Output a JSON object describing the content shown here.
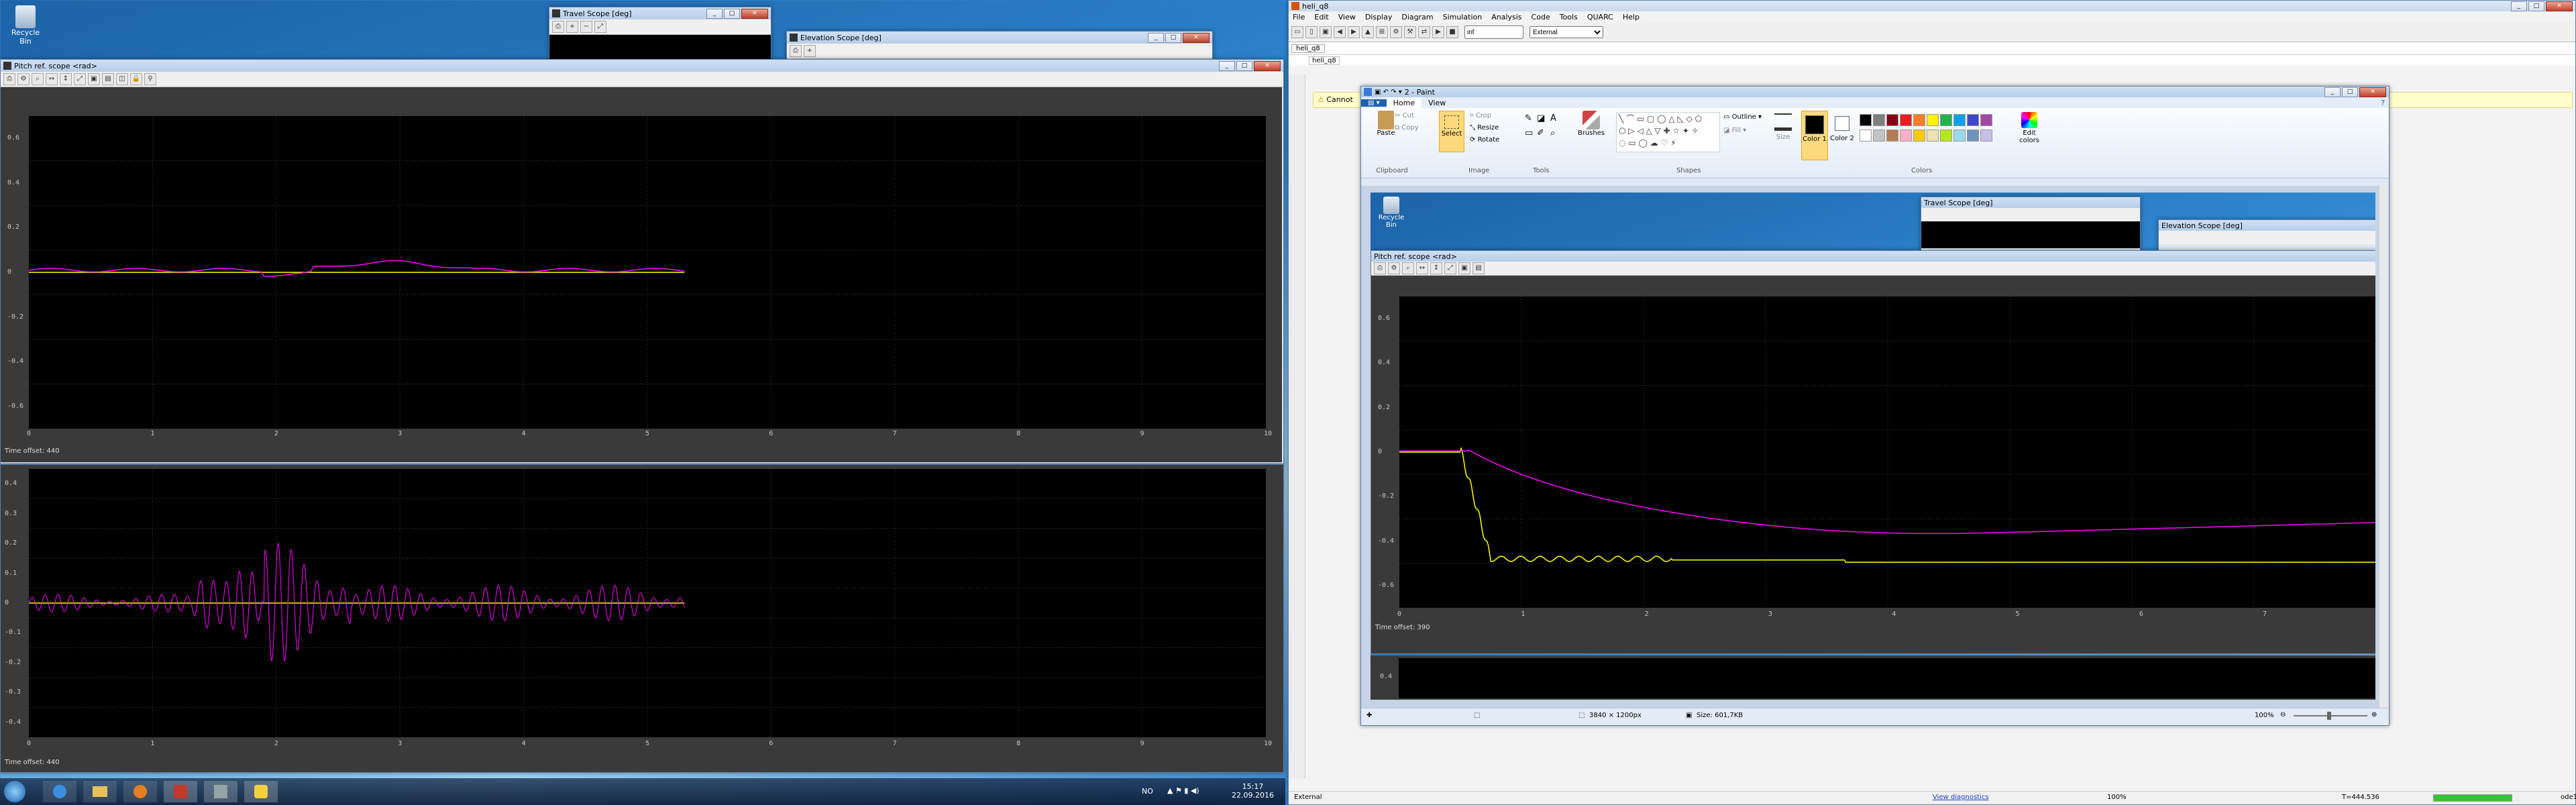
{
  "desktop": {
    "recycle_bin": "Recycle Bin"
  },
  "left_screen": {
    "travel_title": "Travel Scope [deg]",
    "elevation_title": "Elevation Scope [deg]",
    "pitch": {
      "title": "Pitch ref. scope <rad>",
      "yticks": [
        "0.6",
        "0.4",
        "0.2",
        "0",
        "-0.2",
        "-0.4",
        "-0.6"
      ],
      "xticks": [
        "0",
        "1",
        "2",
        "3",
        "4",
        "5",
        "6",
        "7",
        "8",
        "9",
        "10"
      ],
      "time_offset_label": "Time offset:",
      "time_offset_value": "440"
    },
    "lower_scope": {
      "yticks": [
        "0.4",
        "0.3",
        "0.2",
        "0.1",
        "0",
        "-0.1",
        "-0.2",
        "-0.3",
        "-0.4"
      ],
      "xticks": [
        "0",
        "1",
        "2",
        "3",
        "4",
        "5",
        "6",
        "7",
        "8",
        "9",
        "10"
      ],
      "time_offset_label": "Time offset:",
      "time_offset_value": "440"
    }
  },
  "taskbar": {
    "lang": "NO",
    "time": "15:17",
    "date": "22.09.2016"
  },
  "simulink": {
    "title": "heli_q8",
    "menu": [
      "File",
      "Edit",
      "View",
      "Display",
      "Diagram",
      "Simulation",
      "Analysis",
      "Code",
      "Tools",
      "QUARC",
      "Help"
    ],
    "stop_time": "inf",
    "mode": "External",
    "tab": "heli_q8",
    "breadcrumb": "heli_q8",
    "warning": "Cannot",
    "status_mode": "External",
    "status_diag": "View diagnostics",
    "status_zoom": "100%",
    "status_time": "T=444.536",
    "status_solver": "ode1"
  },
  "paint": {
    "title": "2 - Paint",
    "tabs": [
      "Home",
      "View"
    ],
    "clipboard": {
      "paste": "Paste",
      "cut": "Cut",
      "copy": "Copy",
      "group": "Clipboard"
    },
    "image": {
      "select": "Select",
      "crop": "Crop",
      "resize": "Resize",
      "rotate": "Rotate",
      "group": "Image"
    },
    "tools_group": "Tools",
    "brushes": "Brushes",
    "shapes": {
      "outline": "Outline",
      "fill": "Fill",
      "group": "Shapes"
    },
    "size": "Size",
    "color1": "Color 1",
    "color2": "Color 2",
    "edit_colors": "Edit colors",
    "colors_group": "Colors",
    "palette": [
      "#000000",
      "#7f7f7f",
      "#880015",
      "#ed1c24",
      "#ff7f27",
      "#fff200",
      "#22b14c",
      "#00a2e8",
      "#3f48cc",
      "#a349a4",
      "#ffffff",
      "#c3c3c3",
      "#b97a57",
      "#ffaec9",
      "#ffc90e",
      "#efe4b0",
      "#b5e61d",
      "#99d9ea",
      "#7092be",
      "#c8bfe7"
    ],
    "status_dims": "3840 × 1200px",
    "status_size": "Size: 601,7KB",
    "status_zoom": "100%",
    "canvas": {
      "recycle_bin": "Recycle Bin",
      "travel_title": "Travel Scope [deg]",
      "elevation_title": "Elevation Scope [deg]",
      "pitch_title": "Pitch ref. scope <rad>",
      "yticks": [
        "0.6",
        "0.4",
        "0.2",
        "0",
        "-0.2",
        "-0.4",
        "-0.6"
      ],
      "xticks": [
        "0",
        "1",
        "2",
        "3",
        "4",
        "5",
        "6",
        "7"
      ],
      "time_offset_label": "Time offset:",
      "time_offset_value": "390",
      "lower_ytick": "0.4"
    }
  },
  "colors": {
    "magenta": "#ff00ff",
    "yellow": "#ffff00",
    "accent": "#1e5fb0"
  }
}
